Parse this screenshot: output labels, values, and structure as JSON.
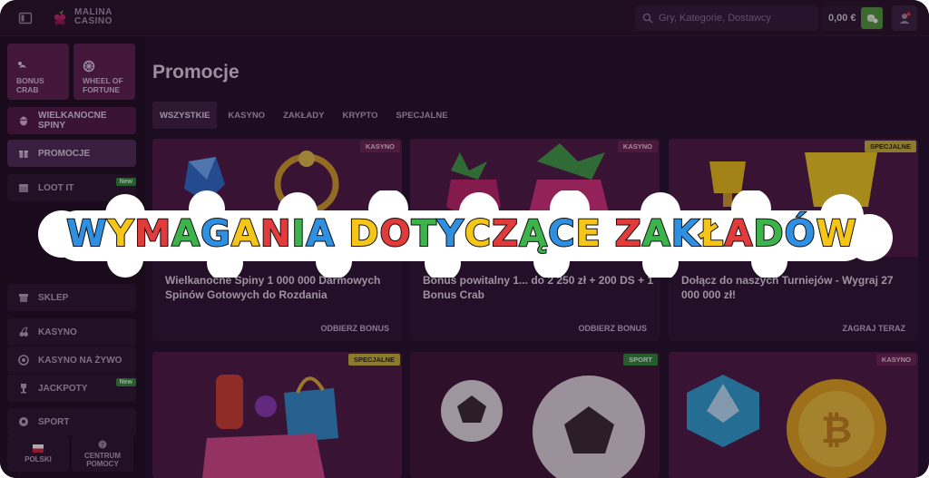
{
  "brand": {
    "line1": "MALINA",
    "line2": "CASINO"
  },
  "search": {
    "placeholder": "Gry, Kategorie, Dostawcy"
  },
  "wallet": {
    "balance": "0,00 €"
  },
  "sidebar": {
    "tiles": [
      {
        "label": "BONUS CRAB",
        "icon": "crab-icon"
      },
      {
        "label": "WHEEL OF FORTUNE",
        "icon": "wheel-icon"
      }
    ],
    "items": [
      {
        "label": "WIELKANOCNE SPINY",
        "icon": "egg-icon"
      },
      {
        "label": "PROMOCJE",
        "icon": "gift-icon"
      },
      {
        "label": "LOOT IT",
        "icon": "chest-icon",
        "badge": "New"
      },
      {
        "label": "SKLEP",
        "icon": "shop-icon"
      },
      {
        "label": "KASYNO",
        "icon": "cherry-icon"
      },
      {
        "label": "KASYNO NA ŻYWO",
        "icon": "chip-icon"
      },
      {
        "label": "JACKPOTY",
        "icon": "trophy-icon",
        "badge": "New"
      },
      {
        "label": "SPORT",
        "icon": "ball-icon"
      }
    ],
    "bottom": [
      {
        "label": "POLSKI",
        "icon": "flag-pl-icon"
      },
      {
        "label": "CENTRUM POMOCY",
        "icon": "help-icon"
      }
    ]
  },
  "main": {
    "title": "Promocje",
    "tabs": [
      "WSZYSTKIE",
      "KASYNO",
      "ZAKŁADY",
      "KRYPTO",
      "SPECJALNE"
    ],
    "active_tab": "WSZYSTKIE",
    "cards": [
      {
        "category": "KASYNO",
        "title": "Wielkanocne Spiny 1 000 000 Darmowych Spinów Gotowych do Rozdania",
        "cta": "ODBIERZ BONUS"
      },
      {
        "category": "KASYNO",
        "title": "Bonus powitalny 1... do 2 250 zł + 200 DS + 1 Bonus Crab",
        "cta": "ODBIERZ BONUS"
      },
      {
        "category": "SPECJALNE",
        "title": "Dołącz do naszych Turniejów - Wygraj 27 000 000 zł!",
        "cta": "ZAGRAJ TERAZ"
      },
      {
        "category": "SPECJALNE",
        "title": "",
        "cta": ""
      },
      {
        "category": "SPORT",
        "title": "",
        "cta": ""
      },
      {
        "category": "KASYNO",
        "title": "",
        "cta": ""
      }
    ]
  },
  "overlay": {
    "text": "WYMAGANIA DOTYCZĄCE ZAKŁADÓW",
    "letter_colors": [
      "#2f8fe0",
      "#f5c518",
      "#e23b3b",
      "#3cb44b"
    ]
  }
}
